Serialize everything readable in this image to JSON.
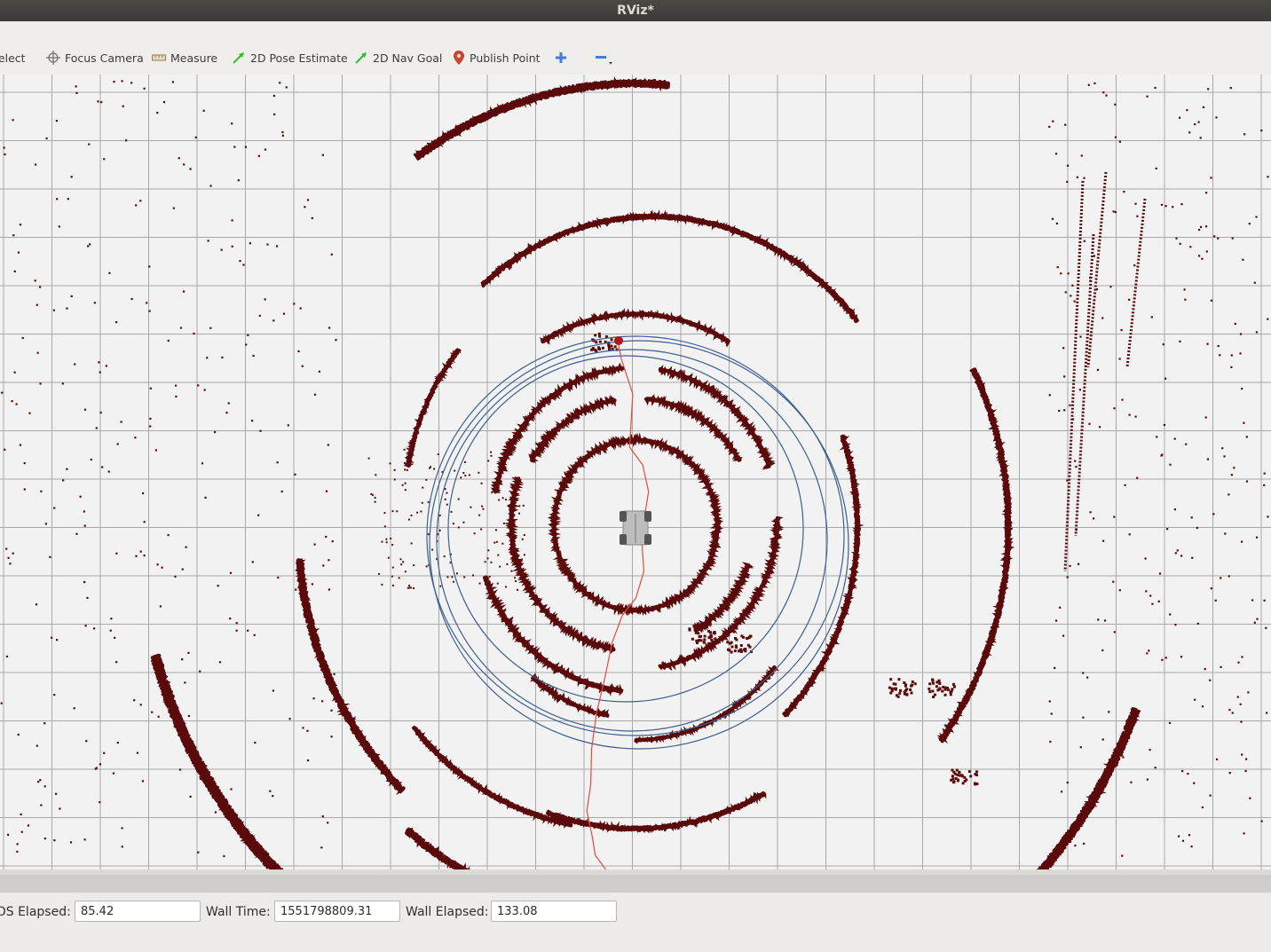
{
  "window": {
    "title": "RViz*"
  },
  "toolbar": {
    "tools": [
      {
        "label": "Select",
        "icon": "cursor-icon"
      },
      {
        "label": "Focus Camera",
        "icon": "crosshair-icon"
      },
      {
        "label": "Measure",
        "icon": "ruler-icon"
      },
      {
        "label": "2D Pose Estimate",
        "icon": "green-arrow-icon"
      },
      {
        "label": "2D Nav Goal",
        "icon": "green-arrow-icon"
      },
      {
        "label": "Publish Point",
        "icon": "map-pin-icon"
      }
    ],
    "add_tool": "plus-icon",
    "remove_tool": "minus-icon"
  },
  "viewport": {
    "description_free": true,
    "colors": {
      "background": "#f2f2f2",
      "grid": "#a8a8a8",
      "laser_points": "#5a0a0a",
      "path": "#e64a3c",
      "circles": "#3d5f8f",
      "robot": "#bdbdbd"
    }
  },
  "time_panel": {
    "ros_elapsed_label": "ROS Elapsed:",
    "ros_elapsed": "85.42",
    "wall_time_label": "Wall Time:",
    "wall_time": "1551798809.31",
    "wall_elapsed_label": "Wall Elapsed:",
    "wall_elapsed": "133.08"
  }
}
